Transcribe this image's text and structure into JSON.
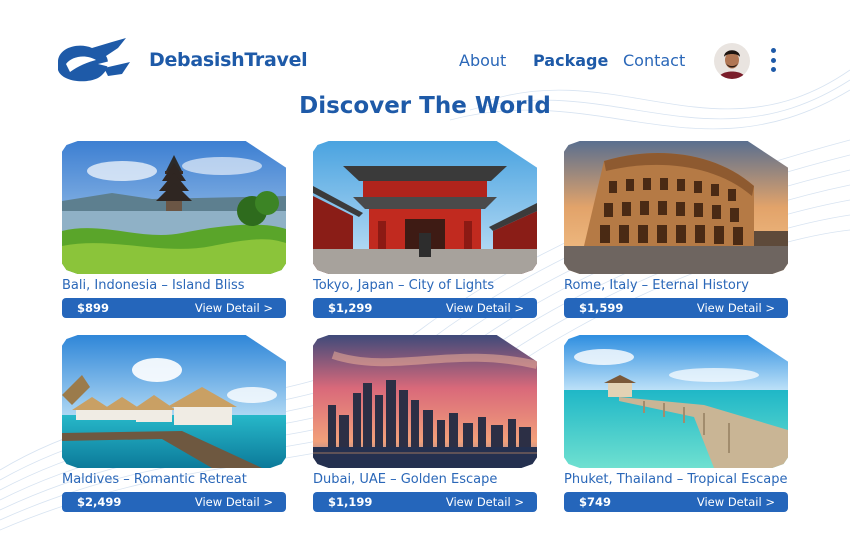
{
  "brand": {
    "name": "DebasishTravel",
    "logo_icon": "airplane-swoosh-icon"
  },
  "nav": {
    "items": [
      {
        "label": "About",
        "active": false
      },
      {
        "label": "Package",
        "active": true
      },
      {
        "label": "Contact",
        "active": false
      }
    ],
    "avatar": "user-avatar",
    "menu_icon": "kebab-menu-icon"
  },
  "hero": {
    "title": "Discover The World"
  },
  "packages": [
    {
      "title": "Bali, Indonesia – Island Bliss",
      "price": "$899",
      "cta": "View Detail >",
      "image": "bali-temple-photo"
    },
    {
      "title": "Tokyo, Japan – City of Lights",
      "price": "$1,299",
      "cta": "View Detail >",
      "image": "tokyo-temple-photo"
    },
    {
      "title": "Rome, Italy – Eternal History",
      "price": "$1,599",
      "cta": "View Detail >",
      "image": "rome-colosseum-photo"
    },
    {
      "title": "Maldives – Romantic Retreat",
      "price": "$2,499",
      "cta": "View Detail >",
      "image": "maldives-villas-photo"
    },
    {
      "title": "Dubai, UAE – Golden Escape",
      "price": "$1,199",
      "cta": "View Detail >",
      "image": "dubai-skyline-photo"
    },
    {
      "title": "Phuket, Thailand – Tropical Escape",
      "price": "$749",
      "cta": "View Detail >",
      "image": "phuket-pier-photo"
    }
  ],
  "colors": {
    "primary": "#1e5aa8",
    "button": "#2566bb",
    "background": "#ffffff"
  }
}
